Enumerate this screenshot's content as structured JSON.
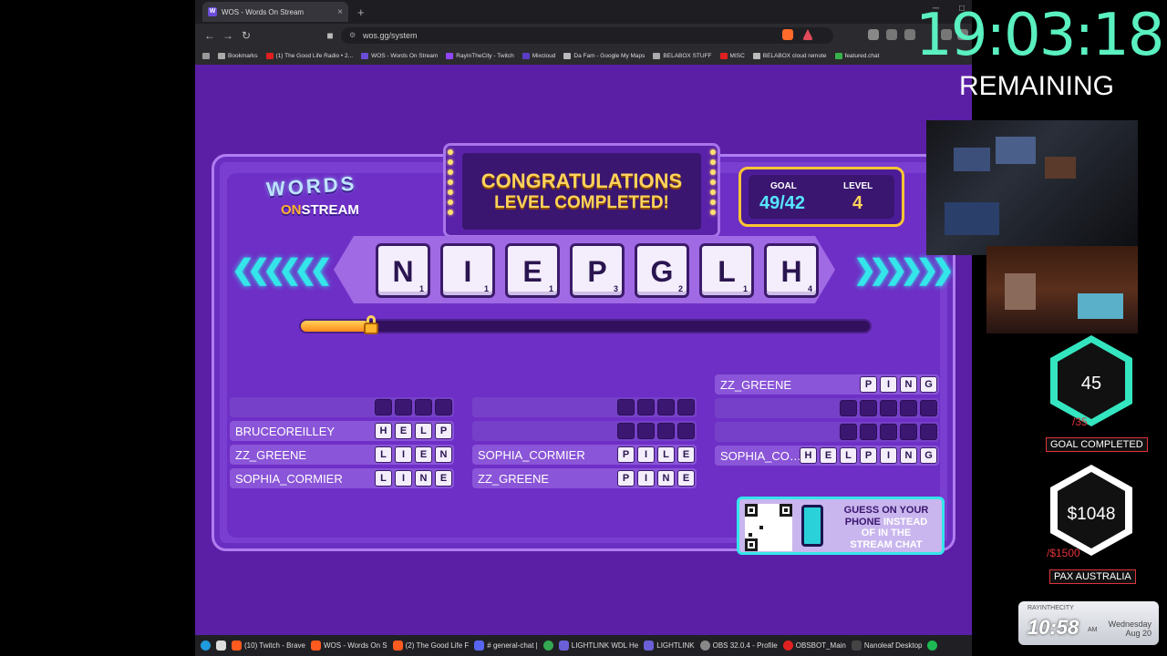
{
  "browser": {
    "tab_title": "WOS - Words On Stream",
    "new_tab": "+",
    "url": "wos.gg/system",
    "bookmarks": [
      "Bookmarks",
      "(1) The Good Life Radio • 2...",
      "WOS - Words On Stream",
      "RayInTheCity - Twitch",
      "Mixcloud",
      "Da Fam - Google My Maps",
      "BELABOX STUFF",
      "MISC",
      "BELABOX cloud remote",
      "featured.chat"
    ]
  },
  "game": {
    "logo_top": "WORDS",
    "logo_on": "ON",
    "logo_bottom": "STREAM",
    "banner_line1": "CONGRATULATIONS",
    "banner_line2": "LEVEL COMPLETED!",
    "goal_label": "GOAL",
    "goal_value": "49/42",
    "level_label": "LEVEL",
    "level_value": "4",
    "tiles": [
      {
        "letter": "N",
        "points": "1"
      },
      {
        "letter": "I",
        "points": "1"
      },
      {
        "letter": "E",
        "points": "1"
      },
      {
        "letter": "P",
        "points": "3"
      },
      {
        "letter": "G",
        "points": "2"
      },
      {
        "letter": "L",
        "points": "1"
      },
      {
        "letter": "H",
        "points": "4"
      }
    ],
    "progress_fraction": 0.12,
    "columns": [
      [
        {
          "name": "",
          "letters": [
            "",
            "",
            "",
            ""
          ]
        },
        {
          "name": "BRUCEOREILLEY",
          "letters": [
            "H",
            "E",
            "L",
            "P"
          ]
        },
        {
          "name": "ZZ_GREENE",
          "letters": [
            "L",
            "I",
            "E",
            "N"
          ]
        },
        {
          "name": "SOPHIA_CORMIER",
          "letters": [
            "L",
            "I",
            "N",
            "E"
          ]
        }
      ],
      [
        {
          "name": "",
          "letters": [
            "",
            "",
            "",
            ""
          ]
        },
        {
          "name": "",
          "letters": [
            "",
            "",
            "",
            ""
          ]
        },
        {
          "name": "SOPHIA_CORMIER",
          "letters": [
            "P",
            "I",
            "L",
            "E"
          ]
        },
        {
          "name": "ZZ_GREENE",
          "letters": [
            "P",
            "I",
            "N",
            "E"
          ]
        }
      ],
      [
        {
          "name": "ZZ_GREENE",
          "letters": [
            "P",
            "I",
            "N",
            "G"
          ]
        },
        {
          "name": "",
          "letters": [
            "",
            "",
            "",
            "",
            ""
          ]
        },
        {
          "name": "",
          "letters": [
            "",
            "",
            "",
            "",
            ""
          ]
        },
        {
          "name": "SOPHIA_CO…",
          "letters": [
            "H",
            "E",
            "L",
            "P",
            "I",
            "N",
            "G"
          ]
        }
      ]
    ],
    "qr_line1": "GUESS ON YOUR",
    "qr_line2a": "PHONE",
    "qr_line2b": "INSTEAD",
    "qr_line3": "OF IN THE",
    "qr_line4": "STREAM CHAT"
  },
  "overlay": {
    "timer": "19:03:18",
    "remaining": "REMAINING",
    "goal_hex_value": "45",
    "goal_hex_target": "/35",
    "goal_hex_label": "GOAL COMPLETED",
    "money_value": "$1048",
    "money_target": "/$1500",
    "money_label": "PAX AUSTRALIA",
    "clock_channel": "RAYINTHECITY",
    "clock_time": "10:58",
    "clock_ampm": "AM",
    "clock_day": "Wednesday",
    "clock_date": "Aug 20",
    "colors": {
      "timer": "#5af0c0",
      "hex_goal": "#34e6c0",
      "hex_money": "#ffffff",
      "tag_border": "#e0333a"
    }
  },
  "taskbar": {
    "items": [
      "(10) Twitch - Brave",
      "WOS - Words On S",
      "(2) The Good Life F",
      "# general-chat |",
      "LIGHTLINK WDL He",
      "LIGHTLINK",
      "OBS 32.0.4 - Profile",
      "OBSBOT_Main",
      "Nanoleaf Desktop"
    ]
  }
}
